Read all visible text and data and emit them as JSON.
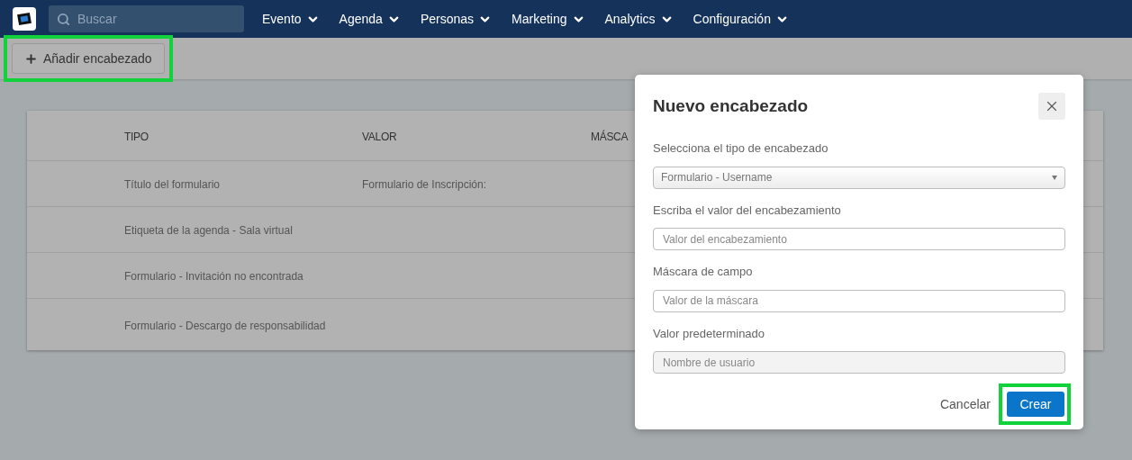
{
  "nav": {
    "search": {
      "placeholder": "Buscar"
    },
    "menus": [
      {
        "label": "Evento"
      },
      {
        "label": "Agenda"
      },
      {
        "label": "Personas"
      },
      {
        "label": "Marketing"
      },
      {
        "label": "Analytics"
      },
      {
        "label": "Configuración"
      }
    ]
  },
  "toolbar": {
    "add_button": {
      "label": "Añadir encabezado",
      "highlighted": true
    }
  },
  "table": {
    "columns": [
      "TIPO",
      "VALOR",
      "MÁSCA"
    ],
    "rows": [
      [
        "Título del formulario",
        "Formulario de Inscripción:"
      ],
      [
        "Etiqueta de la agenda - Sala virtual",
        ""
      ],
      [
        "Formulario - Invitación no encontrada",
        ""
      ],
      [
        "Formulario - Descargo de responsabilidad",
        ""
      ]
    ]
  },
  "dialog": {
    "title": "Nuevo encabezado",
    "fields": [
      {
        "kind": "select",
        "label": "Selecciona el tipo de encabezado",
        "value": "Formulario - Username"
      },
      {
        "kind": "text",
        "label": "Escriba el valor del encabezamiento",
        "placeholder": "Valor del encabezamiento"
      },
      {
        "kind": "text",
        "label": "Máscara de campo",
        "placeholder": "Valor de la máscara"
      },
      {
        "kind": "text",
        "label": "Valor predeterminado",
        "placeholder": "Nombre de usuario",
        "disabled": true
      }
    ],
    "cancel": "Cancelar",
    "create": {
      "label": "Crear",
      "highlighted": true
    }
  }
}
